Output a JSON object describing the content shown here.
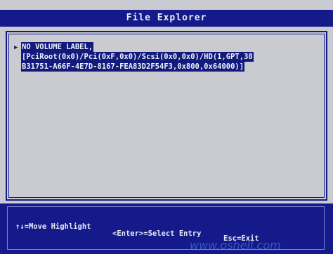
{
  "window": {
    "title": "File Explorer"
  },
  "entries": [
    {
      "lines": [
        "NO VOLUME LABEL,",
        "[PciRoot(0x0)/Pci(0xF,0x0)/Scsi(0x0,0x0)/HD(1,GPT,38",
        "B31751-A66F-4E7D-8167-FEA83D2F54F3,0x800,0x64000)]"
      ]
    }
  ],
  "footer": {
    "move_hint": "↑↓=Move Highlight",
    "select_hint": "<Enter>=Select Entry",
    "exit_hint": "Esc=Exit"
  },
  "watermark": "www.oshell.com"
}
